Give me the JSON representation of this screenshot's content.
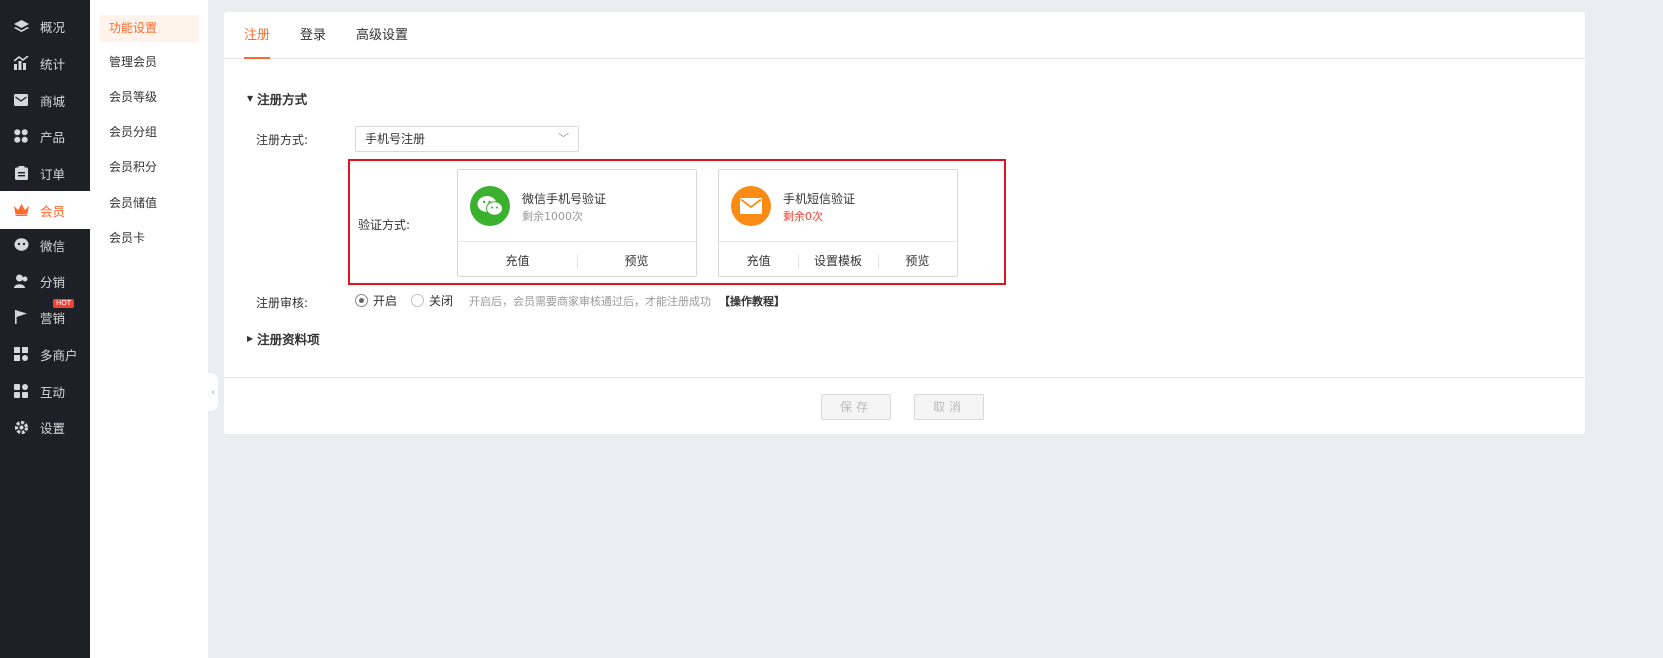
{
  "sidebar": {
    "items": [
      {
        "label": "概况",
        "icon": "layers-icon"
      },
      {
        "label": "统计",
        "icon": "chart-icon"
      },
      {
        "label": "商城",
        "icon": "mail-icon"
      },
      {
        "label": "产品",
        "icon": "grid-icon"
      },
      {
        "label": "订单",
        "icon": "clipboard-icon"
      },
      {
        "label": "会员",
        "icon": "crown-icon",
        "active": true
      },
      {
        "label": "微信",
        "icon": "wechat-icon"
      },
      {
        "label": "分销",
        "icon": "users-icon"
      },
      {
        "label": "营销",
        "icon": "flag-icon",
        "badge": "HOT"
      },
      {
        "label": "多商户",
        "icon": "store-icon"
      },
      {
        "label": "互动",
        "icon": "interact-icon"
      },
      {
        "label": "设置",
        "icon": "gear-icon"
      }
    ]
  },
  "subnav": {
    "items": [
      "功能设置",
      "管理会员",
      "会员等级",
      "会员分组",
      "会员积分",
      "会员储值",
      "会员卡"
    ]
  },
  "tabs": [
    "注册",
    "登录",
    "高级设置"
  ],
  "form": {
    "section_title": "注册方式",
    "reg_method_label": "注册方式:",
    "reg_method_value": "手机号注册",
    "verify_label": "验证方式:",
    "wechat_card": {
      "name": "微信手机号验证",
      "remain": "剩余1000次",
      "actions": [
        "充值",
        "预览"
      ]
    },
    "sms_card": {
      "name": "手机短信验证",
      "remain": "剩余0次",
      "actions": [
        "充值",
        "设置模板",
        "预览"
      ]
    },
    "audit_label": "注册审核:",
    "audit_on": "开启",
    "audit_off": "关闭",
    "audit_hint": "开启后，会员需要商家审核通过后，才能注册成功",
    "tutorial_link": "【操作教程】",
    "profile_section_title": "注册资料项"
  },
  "footer": {
    "save": "保存",
    "cancel": "取消"
  },
  "colors": {
    "accent": "#ff6a2b",
    "sidebar_bg": "#1d2026",
    "highlight": "#e0141e",
    "wechat_green": "#3bb12f",
    "sms_orange": "#fa8c16"
  }
}
